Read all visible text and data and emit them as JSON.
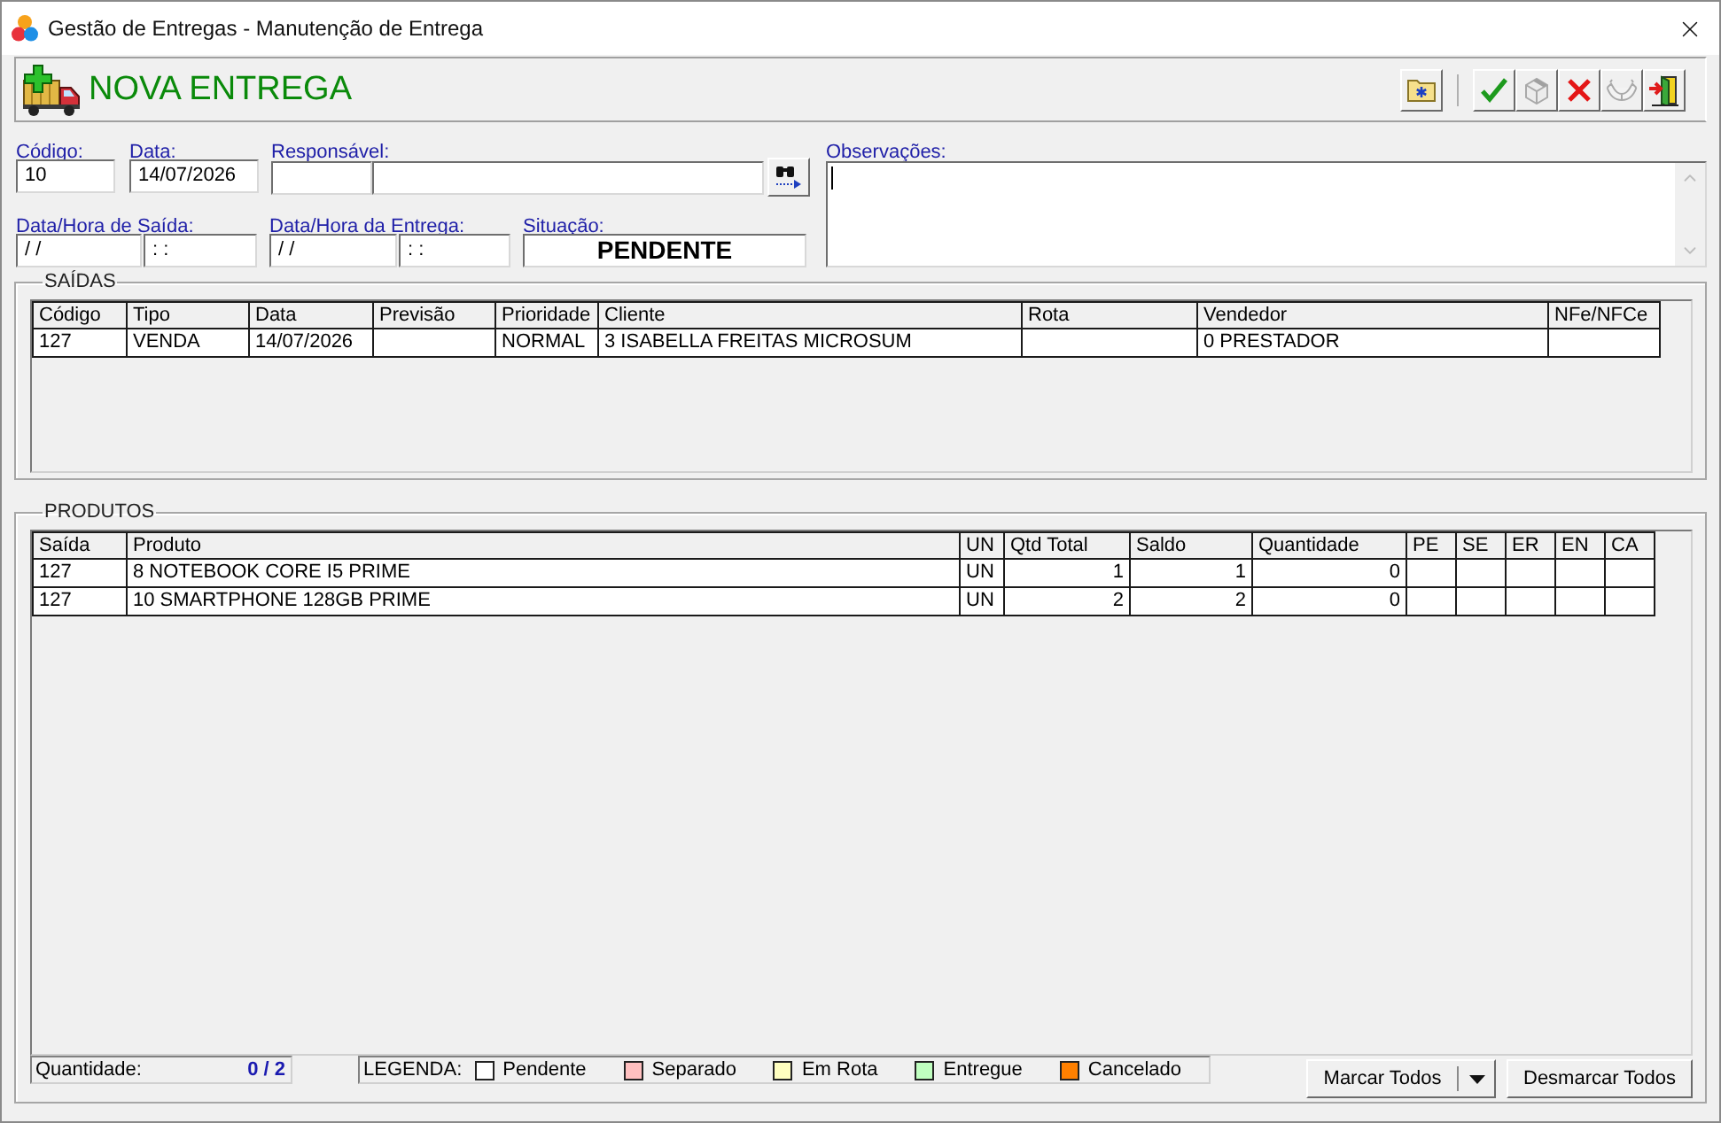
{
  "window": {
    "title": "Gestão de Entregas - Manutenção de Entrega"
  },
  "header": {
    "title": "NOVA ENTREGA",
    "toolbar": [
      {
        "buttons": [
          {
            "kind": "new-folder",
            "disabled": false
          }
        ]
      },
      {
        "buttons": [
          {
            "kind": "confirm",
            "disabled": false
          },
          {
            "kind": "box",
            "disabled": true
          },
          {
            "kind": "cancel",
            "disabled": false
          },
          {
            "kind": "hands",
            "disabled": true
          },
          {
            "kind": "exit",
            "disabled": false
          }
        ]
      }
    ]
  },
  "form": {
    "codigo": {
      "label": "Código:",
      "value": "10"
    },
    "data": {
      "label": "Data:",
      "value": "14/07/2026"
    },
    "responsavel": {
      "label": "Responsável:"
    },
    "observacoes": {
      "label": "Observações:",
      "focused": true
    },
    "saida": {
      "label": "Data/Hora de Saída:",
      "date": "/ /",
      "time": ": :"
    },
    "entrega": {
      "label": "Data/Hora da Entrega:",
      "date": "/ /",
      "time": ": :"
    },
    "situacao": {
      "label": "Situação:",
      "value": "PENDENTE"
    }
  },
  "saidas": {
    "title": "SAÍDAS",
    "columns": [
      "Código",
      "Tipo",
      "Data",
      "Previsão",
      "Prioridade",
      "Cliente",
      "Rota",
      "Vendedor",
      "NFe/NFCe"
    ],
    "rows": [
      {
        "codigo": "127",
        "tipo": "VENDA",
        "data": "14/07/2026",
        "prioridade": "NORMAL",
        "cliente": "3 ISABELLA FREITAS MICROSUM",
        "vendedor": "0 PRESTADOR"
      }
    ]
  },
  "produtos": {
    "title": "PRODUTOS",
    "columns": [
      "Saída",
      "Produto",
      "UN",
      "Qtd Total",
      "Saldo",
      "Quantidade",
      "PE",
      "SE",
      "ER",
      "EN",
      "CA"
    ],
    "rows": [
      {
        "saida": "127",
        "produto": "8 NOTEBOOK CORE I5 PRIME",
        "un": "UN",
        "qtd_total": "1",
        "saldo": "1",
        "quantidade": "0"
      },
      {
        "saida": "127",
        "produto": "10 SMARTPHONE 128GB PRIME",
        "un": "UN",
        "qtd_total": "2",
        "saldo": "2",
        "quantidade": "0"
      }
    ]
  },
  "quantidade": {
    "label": "Quantidade:",
    "value": "0 / 2"
  },
  "legenda": {
    "label": "LEGENDA:",
    "items": [
      {
        "label": "Pendente",
        "color": "#ffffff"
      },
      {
        "label": "Separado",
        "color": "#ffc0c0"
      },
      {
        "label": "Em Rota",
        "color": "#ffffc0"
      },
      {
        "label": "Entregue",
        "color": "#c0ffc0"
      },
      {
        "label": "Cancelado",
        "color": "#ff8000"
      }
    ]
  },
  "buttons": [
    {
      "label": "Marcar Todos",
      "kind": "split"
    },
    {
      "label": "Desmarcar Todos",
      "kind": "plain"
    }
  ]
}
